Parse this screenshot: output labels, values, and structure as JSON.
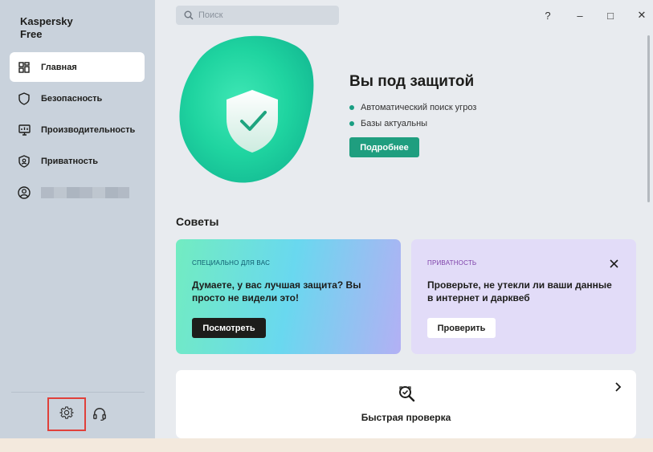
{
  "app": {
    "title": "Kaspersky\nFree"
  },
  "sidebar": {
    "items": [
      {
        "label": "Главная",
        "icon": "home-grid-icon",
        "active": true
      },
      {
        "label": "Безопасность",
        "icon": "shield-icon"
      },
      {
        "label": "Производительность",
        "icon": "monitor-icon"
      },
      {
        "label": "Приватность",
        "icon": "privacy-shield-icon"
      },
      {
        "label": "",
        "icon": "user-avatar-icon",
        "blurred": true
      }
    ],
    "footer": {
      "settings_icon": "gear-icon",
      "support_icon": "headset-icon"
    }
  },
  "search": {
    "placeholder": "Поиск",
    "value": ""
  },
  "window_controls": {
    "help": "?",
    "minimize": "–",
    "maximize": "□",
    "close": "✕"
  },
  "hero": {
    "title": "Вы под защитой",
    "status": [
      "Автоматический поиск угроз",
      "Базы актуальны"
    ],
    "button": "Подробнее"
  },
  "tips": {
    "title": "Советы",
    "cards": [
      {
        "tag": "СПЕЦИАЛЬНО ДЛЯ ВАС",
        "text": "Думаете, у вас лучшая защита? Вы просто не видели это!",
        "button": "Посмотреть"
      },
      {
        "tag": "ПРИВАТНОСТЬ",
        "text": "Проверьте, не утекли ли ваши данные в интернет и дарквеб",
        "button": "Проверить"
      }
    ]
  },
  "quick_scan": {
    "label": "Быстрая проверка"
  },
  "colors": {
    "accent": "#1f9e7f",
    "sidebar": "#c9d2dc",
    "content": "#e8ebef",
    "highlight_border": "#e0403a"
  }
}
